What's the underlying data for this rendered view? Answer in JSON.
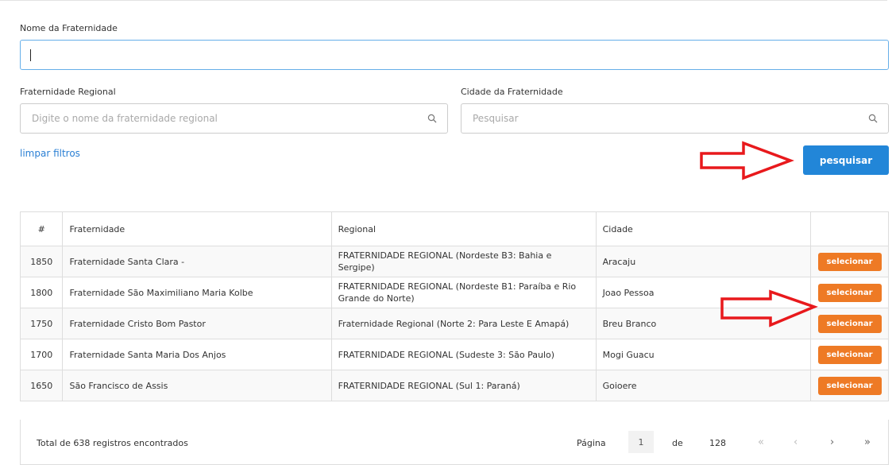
{
  "filters": {
    "nome_label": "Nome da Fraternidade",
    "nome_value": "",
    "regional_label": "Fraternidade Regional",
    "regional_placeholder": "Digite o nome da fraternidade regional",
    "cidade_label": "Cidade da Fraternidade",
    "cidade_placeholder": "Pesquisar",
    "clear_label": "limpar filtros",
    "search_button": "pesquisar"
  },
  "table": {
    "headers": [
      "#",
      "Fraternidade",
      "Regional",
      "Cidade",
      ""
    ],
    "rows": [
      {
        "num": "1850",
        "fraternidade": "Fraternidade Santa Clara -",
        "regional": "FRATERNIDADE REGIONAL (Nordeste B3: Bahia e Sergipe)",
        "cidade": "Aracaju",
        "action": "selecionar"
      },
      {
        "num": "1800",
        "fraternidade": "Fraternidade São Maximiliano Maria Kolbe",
        "regional": "FRATERNIDADE REGIONAL (Nordeste B1: Paraíba e Rio Grande do Norte)",
        "cidade": "Joao Pessoa",
        "action": "selecionar"
      },
      {
        "num": "1750",
        "fraternidade": "Fraternidade Cristo Bom Pastor",
        "regional": "Fraternidade Regional (Norte 2: Para Leste E Amapá)",
        "cidade": "Breu Branco",
        "action": "selecionar"
      },
      {
        "num": "1700",
        "fraternidade": "Fraternidade Santa Maria Dos Anjos",
        "regional": "FRATERNIDADE REGIONAL (Sudeste 3: São Paulo)",
        "cidade": "Mogi Guacu",
        "action": "selecionar"
      },
      {
        "num": "1650",
        "fraternidade": "São Francisco de Assis",
        "regional": "FRATERNIDADE REGIONAL (Sul 1: Paraná)",
        "cidade": "Goioere",
        "action": "selecionar"
      }
    ]
  },
  "pagination": {
    "total_text": "Total de 638 registros encontrados",
    "page_label": "Página",
    "current_page": "1",
    "of_label": "de",
    "total_pages": "128",
    "first": "«",
    "prev": "‹",
    "next": "›",
    "last": "»"
  },
  "icons": {
    "regional_search": "search-icon",
    "cidade_search": "search-icon",
    "annotation_arrow": "right-arrow-outline"
  },
  "colors": {
    "primary_button": "#2286d8",
    "select_button": "#ee7a25",
    "link": "#2a7fd4",
    "annotation_arrow": "#e8191c"
  }
}
